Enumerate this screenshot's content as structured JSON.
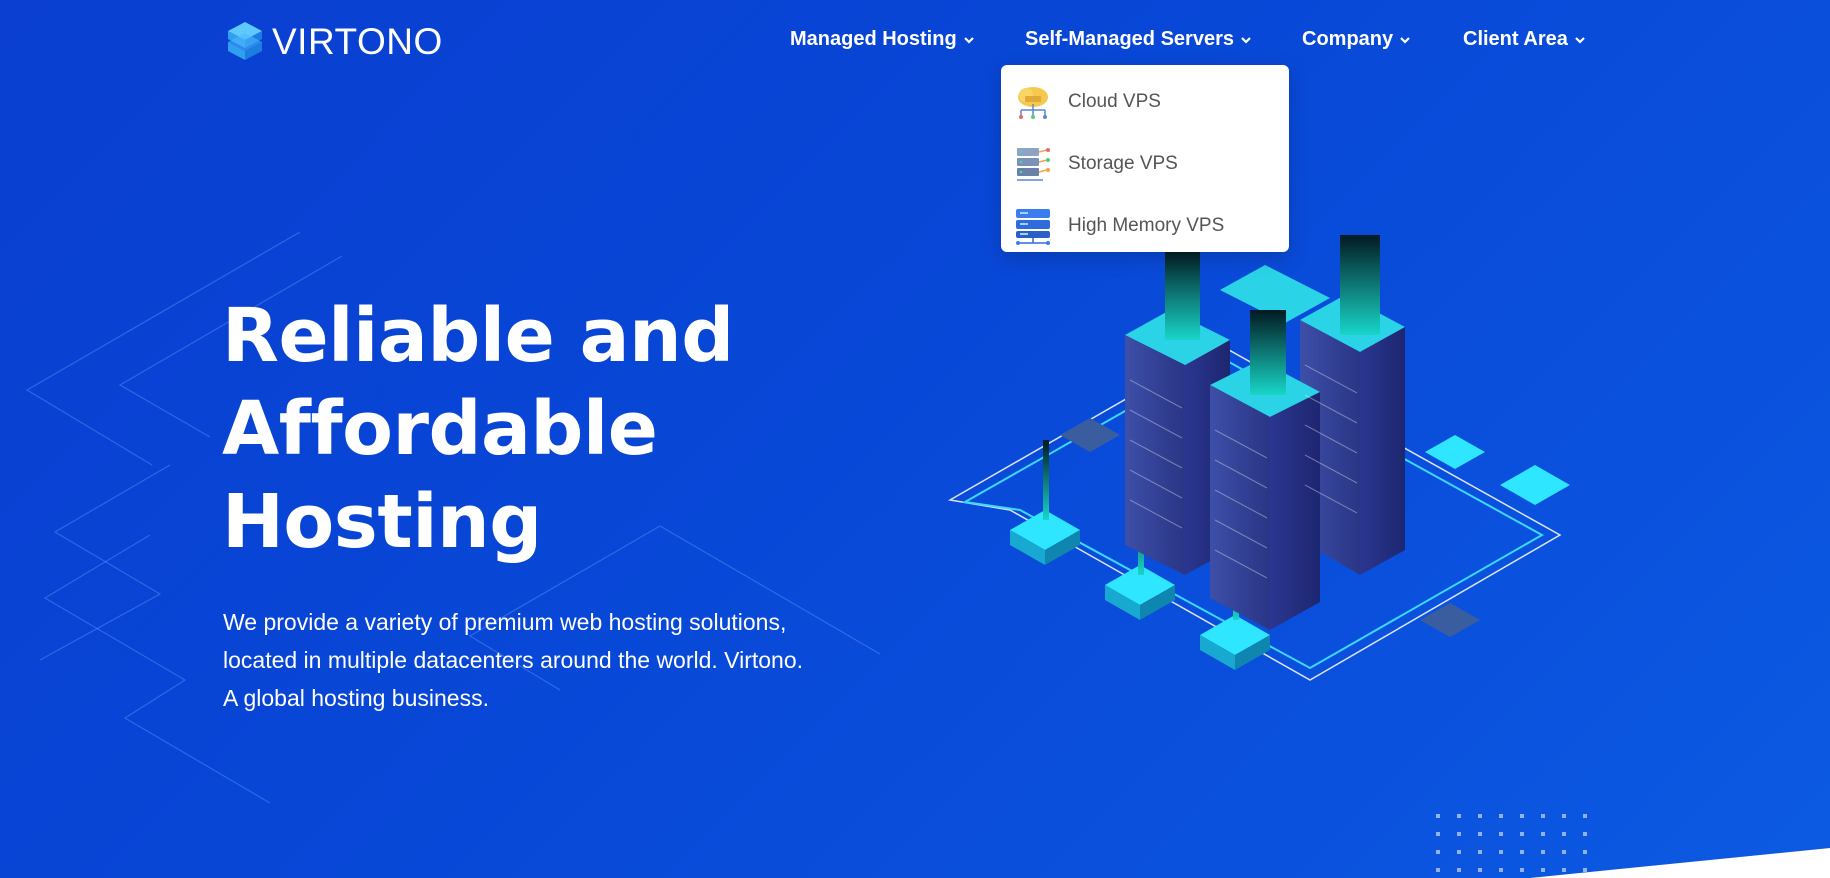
{
  "brand": {
    "name": "VIRTONO",
    "logo_icon": "stacked-layers-icon"
  },
  "nav": [
    {
      "label": "Managed Hosting"
    },
    {
      "label": "Self-Managed Servers"
    },
    {
      "label": "Company"
    },
    {
      "label": "Client Area"
    }
  ],
  "dropdown": {
    "items": [
      {
        "label": "Cloud VPS",
        "icon": "cloud-server-icon"
      },
      {
        "label": "Storage VPS",
        "icon": "storage-server-icon"
      },
      {
        "label": "High Memory VPS",
        "icon": "memory-server-icon"
      }
    ]
  },
  "hero": {
    "title_lines": [
      "Reliable and",
      "Affordable",
      "Hosting"
    ],
    "subtitle_lines": [
      "We provide a variety of premium web hosting solutions,",
      "located in multiple datacenters around the world. Virtono.",
      "A global hosting business."
    ]
  },
  "colors": {
    "background": "#0a45d6",
    "accent_cyan": "#22e0f0",
    "dropdown_bg": "#ffffff"
  }
}
